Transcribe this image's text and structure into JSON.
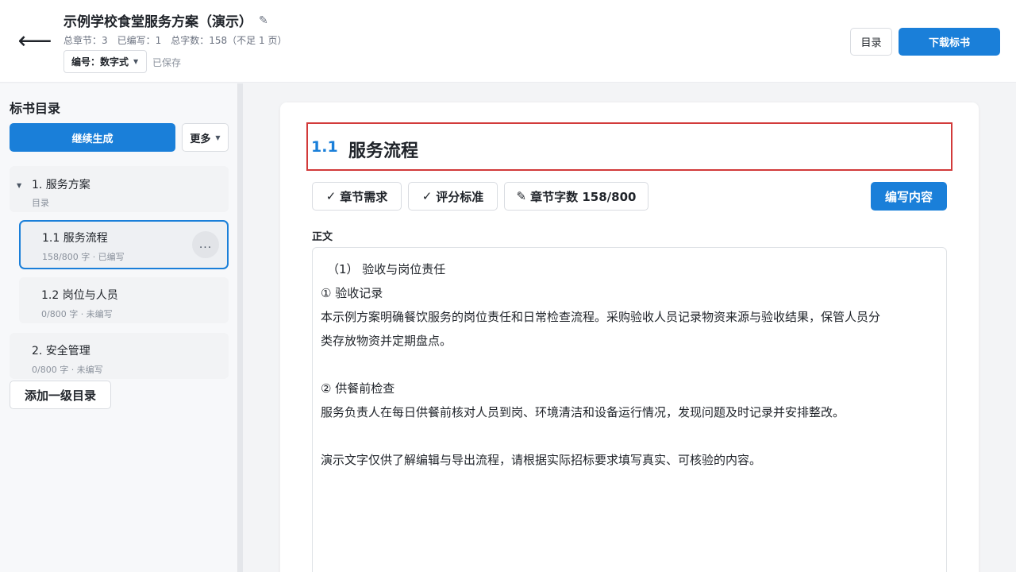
{
  "header": {
    "back_icon": "arrow-left-icon",
    "title": "示例学校食堂服务方案（演示）",
    "edit_icon": "pencil-icon",
    "meta": {
      "total_sections": "总章节：3",
      "written": "已编写：1",
      "word_count": "总字数：158（不足 1 页）"
    },
    "numbering_label": "编号：数字式",
    "saved_status": "已保存",
    "toc_button": "目录",
    "download_button": "下载标书"
  },
  "sidebar": {
    "title": "标书目录",
    "continue_button": "继续生成",
    "more_button": "更多",
    "add_root_button": "添加一级目录",
    "nodes": [
      {
        "label": "1. 服务方案",
        "sub": "目录"
      },
      {
        "label": "1.1 服务流程",
        "sub": "158/800 字 · 已编写",
        "more": "..."
      },
      {
        "label": "1.2 岗位与人员",
        "sub": "0/800 字 · 未编写"
      },
      {
        "label": "2. 安全管理",
        "sub": "0/800 字 · 未编写"
      }
    ]
  },
  "editor": {
    "section_number": "1.1",
    "section_title": "服务流程",
    "chips": {
      "requirements": "章节需求",
      "scoring": "评分标准",
      "word_count": "章节字数 158/800"
    },
    "write_button": "编写内容",
    "body_label": "正文",
    "body_lines": [
      "（1） 验收与岗位责任",
      "① 验收记录",
      "本示例方案明确餐饮服务的岗位责任和日常检查流程。采购验收人员记录物资来源与验收结果，保管人员分",
      "类存放物资并定期盘点。",
      "",
      "② 供餐前检查",
      "服务负责人在每日供餐前核对人员到岗、环境清洁和设备运行情况，发现问题及时记录并安排整改。",
      "",
      "演示文字仅供了解编辑与导出流程，请根据实际招标要求填写真实、可核验的内容。"
    ]
  },
  "colors": {
    "accent": "#1a7fd9",
    "highlight_border": "#d23a3a"
  }
}
